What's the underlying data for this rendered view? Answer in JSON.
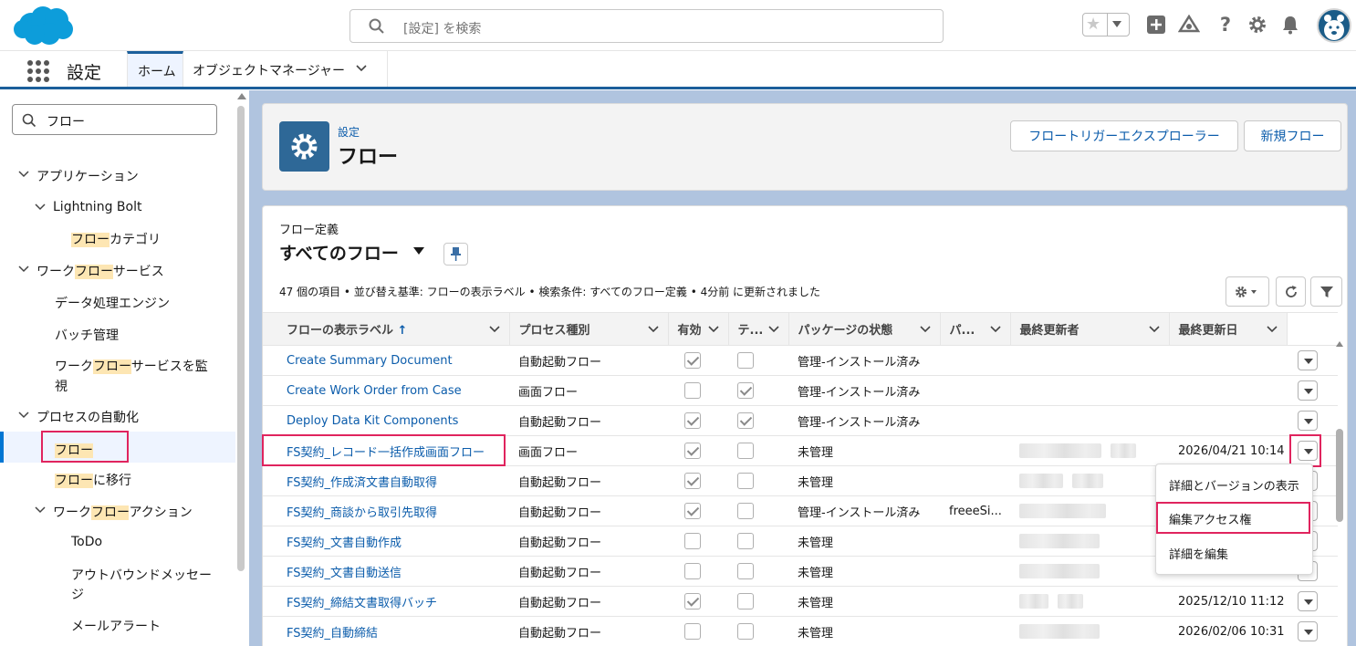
{
  "header": {
    "search_placeholder": "[設定] を検索",
    "icons": [
      "favorites-star-icon",
      "chevron-down-icon",
      "add-icon",
      "trailhead-icon",
      "help-icon",
      "gear-icon",
      "bell-icon",
      "avatar"
    ]
  },
  "appnav": {
    "app_title": "設定",
    "tabs": [
      {
        "label": "ホーム",
        "active": true
      },
      {
        "label": "オブジェクトマネージャー",
        "active": false
      }
    ]
  },
  "sidebar": {
    "quickfind_value": "フロー",
    "tree": {
      "apps": "アプリケーション",
      "lightning_bolt": "Lightning Bolt",
      "flow_category_hl": "フロー",
      "flow_category_rest": "カテゴリ",
      "workflow_services_pre": "ワーク",
      "workflow_services_hl": "フロー",
      "workflow_services_post": "サービス",
      "data_processing": "データ処理エンジン",
      "batch": "バッチ管理",
      "monitor_pre": "ワーク",
      "monitor_hl": "フロー",
      "monitor_post1": "サービスを監",
      "monitor_post2": "視",
      "process_automation": "プロセスの自動化",
      "flow_hl": "フロー",
      "migrate_hl": "フロー",
      "migrate_rest": "に移行",
      "wf_actions_pre": "ワーク",
      "wf_actions_hl": "フロー",
      "wf_actions_post": "アクション",
      "todo": "ToDo",
      "outbound1": "アウトバウンドメッセー",
      "outbound2": "ジ",
      "email_alert": "メールアラート"
    }
  },
  "pagehead": {
    "breadcrumb": "設定",
    "title": "フロー",
    "btn_trigger_explorer": "フロートリガーエクスプローラー",
    "btn_new_flow": "新規フロー"
  },
  "listview": {
    "object_label": "フロー定義",
    "view_name": "すべてのフロー",
    "info": "47 個の項目 • 並び替え基準: フローの表示ラベル • 検索条件: すべてのフロー定義 • 4分前 に更新されました",
    "columns": {
      "label": "フローの表示ラベル",
      "sort_indicator": "↑",
      "process_type": "プロセス種別",
      "active": "有効",
      "template": "テ...",
      "package_state": "パッケージの状態",
      "package": "パ...",
      "last_modified_by": "最終更新者",
      "last_modified_date": "最終更新日"
    },
    "rows": [
      {
        "label": "Create Summary Document",
        "type": "自動起動フロー",
        "active": true,
        "template": false,
        "pkg_state": "管理-インストール済み",
        "pkg": "",
        "modified_by_blurred": false,
        "modified_date": ""
      },
      {
        "label": "Create Work Order from Case",
        "type": "画面フロー",
        "active": false,
        "template": true,
        "pkg_state": "管理-インストール済み",
        "pkg": "",
        "modified_by_blurred": false,
        "modified_date": ""
      },
      {
        "label": "Deploy Data Kit Components",
        "type": "自動起動フロー",
        "active": true,
        "template": true,
        "pkg_state": "管理-インストール済み",
        "pkg": "",
        "modified_by_blurred": false,
        "modified_date": ""
      },
      {
        "label": "FS契約_レコード一括作成画面フロー",
        "type": "画面フロー",
        "active": true,
        "template": false,
        "pkg_state": "未管理",
        "pkg": "",
        "modified_by_blurred": true,
        "modified_date": "2026/04/21 10:14"
      },
      {
        "label": "FS契約_作成済文書自動取得",
        "type": "自動起動フロー",
        "active": true,
        "template": false,
        "pkg_state": "未管理",
        "pkg": "",
        "modified_by_blurred": true,
        "modified_date": ""
      },
      {
        "label": "FS契約_商談から取引先取得",
        "type": "自動起動フロー",
        "active": true,
        "template": false,
        "pkg_state": "管理-インストール済み",
        "pkg": "freeeSi...",
        "modified_by_blurred": true,
        "modified_date": ""
      },
      {
        "label": "FS契約_文書自動作成",
        "type": "自動起動フロー",
        "active": false,
        "template": false,
        "pkg_state": "未管理",
        "pkg": "",
        "modified_by_blurred": true,
        "modified_date": ""
      },
      {
        "label": "FS契約_文書自動送信",
        "type": "自動起動フロー",
        "active": false,
        "template": false,
        "pkg_state": "未管理",
        "pkg": "",
        "modified_by_blurred": true,
        "modified_date": ""
      },
      {
        "label": "FS契約_締結文書取得バッチ",
        "type": "自動起動フロー",
        "active": true,
        "template": false,
        "pkg_state": "未管理",
        "pkg": "",
        "modified_by_blurred": true,
        "modified_date": "2025/12/10 11:12"
      },
      {
        "label": "FS契約_自動締結",
        "type": "自動起動フロー",
        "active": false,
        "template": false,
        "pkg_state": "未管理",
        "pkg": "",
        "modified_by_blurred": true,
        "modified_date": "2026/02/06 10:31"
      }
    ]
  },
  "row_menu": {
    "items": [
      "詳細とバージョンの表示",
      "編集アクセス権",
      "詳細を編集"
    ],
    "highlighted": "編集アクセス権"
  },
  "colors": {
    "brand_blue": "#0b5cab",
    "nav_accent": "#1b5f9b",
    "highlight_bg": "#fde6b3",
    "annotation_red": "#e0245e",
    "page_bg": "#b0c4df"
  }
}
